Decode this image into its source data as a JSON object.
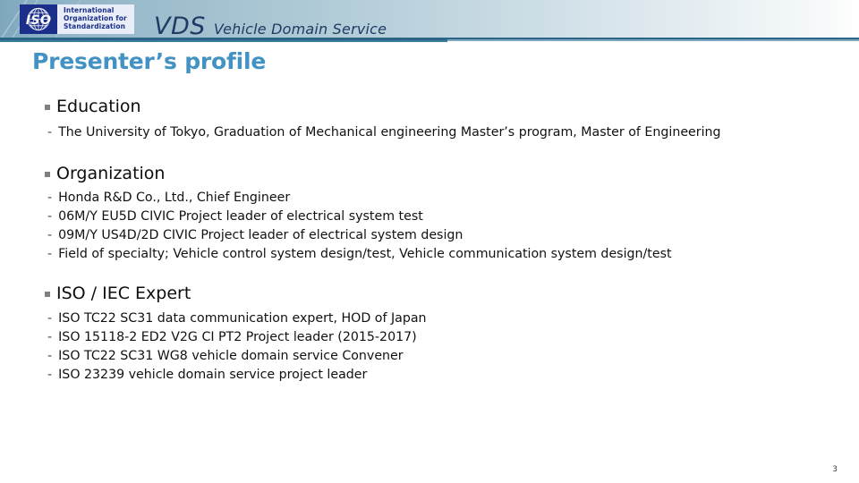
{
  "header": {
    "logo": {
      "mark_label": "ISO",
      "icon": "iso-globe-icon",
      "line1": "International",
      "line2": "Organization for",
      "line3": "Standardization"
    },
    "title_abbr": "VDS",
    "title_full": "Vehicle Domain Service"
  },
  "slide": {
    "title": "Presenter’s profile",
    "page_number": "3",
    "accent_color": "#4292c4",
    "header_rule_color": "#2a6486",
    "logo_blue": "#1b2f8a"
  },
  "sections": [
    {
      "heading": "Education",
      "bullet": "square-bullet-icon",
      "items": [
        {
          "dash": "-",
          "text": "The University of Tokyo, Graduation of Mechanical engineering Master’s program, Master of Engineering"
        }
      ]
    },
    {
      "heading": "Organization",
      "bullet": "square-bullet-icon",
      "items": [
        {
          "dash": "-",
          "text": "Honda R&D Co., Ltd., Chief Engineer"
        },
        {
          "dash": "-",
          "text": "06M/Y EU5D CIVIC Project leader of electrical system test"
        },
        {
          "dash": "-",
          "text": "09M/Y US4D/2D CIVIC Project leader of electrical system design"
        },
        {
          "dash": "-",
          "text": "Field of specialty; Vehicle control system design/test, Vehicle communication system design/test"
        }
      ]
    },
    {
      "heading": "ISO / IEC Expert",
      "bullet": "square-bullet-icon",
      "items": [
        {
          "dash": "-",
          "text": "ISO TC22 SC31 data communication expert, HOD of Japan"
        },
        {
          "dash": "-",
          "text": "ISO 15118-2 ED2 V2G CI PT2 Project leader (2015-2017)"
        },
        {
          "dash": "-",
          "text": "ISO TC22 SC31 WG8 vehicle domain service Convener"
        },
        {
          "dash": "-",
          "text": "ISO 23239 vehicle domain service project leader"
        }
      ]
    }
  ]
}
